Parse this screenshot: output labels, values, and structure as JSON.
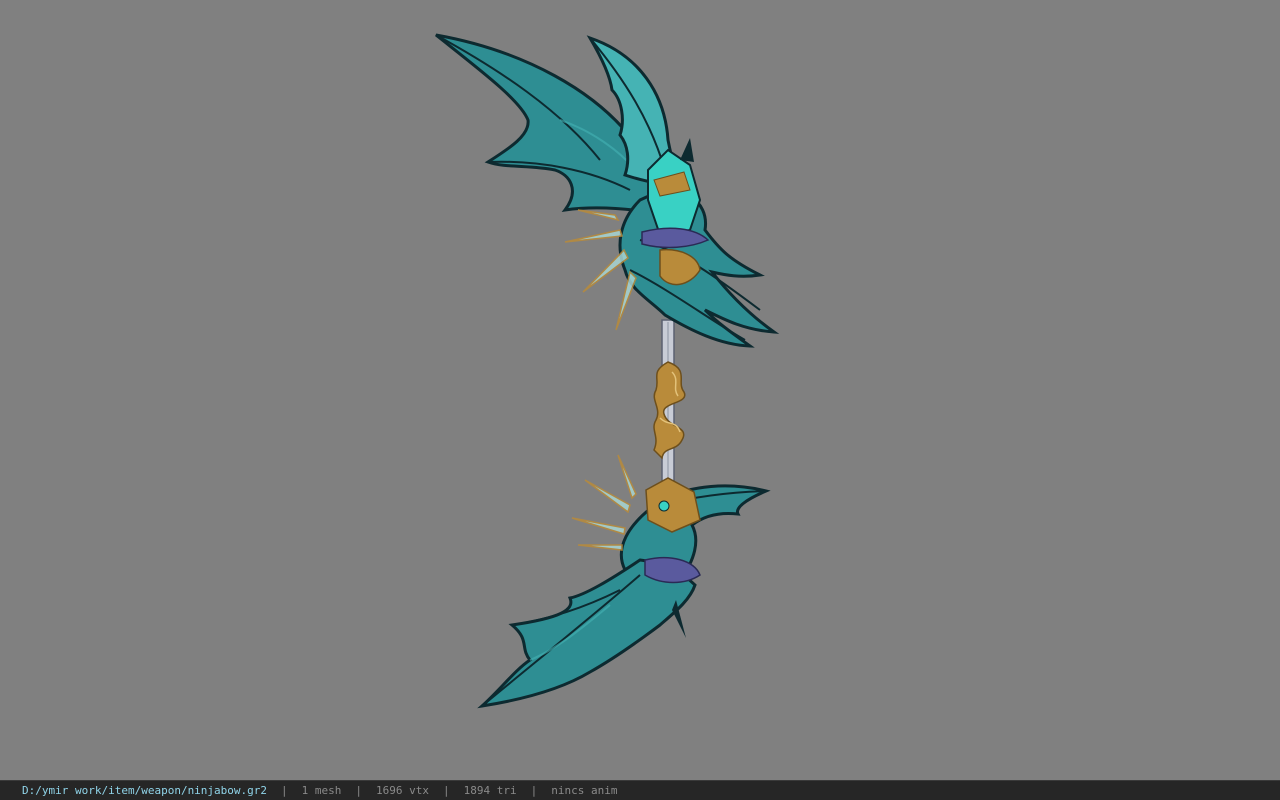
{
  "viewport": {
    "background_color": "#808080",
    "model_name": "ninjabow",
    "colors": {
      "wing": "#2e8e93",
      "wing_light": "#45b3b4",
      "wing_edge": "#0d2a30",
      "gold": "#b98b3a",
      "shaft": "#c8ccd6",
      "gem": "#39d1c4"
    }
  },
  "status": {
    "file_path": "D:/ymir work/item/weapon/ninjabow.gr2",
    "separator": "|",
    "mesh_count": "1 mesh",
    "vertex_count": "1696 vtx",
    "triangle_count": "1894 tri",
    "anim_status": "nincs anim"
  }
}
